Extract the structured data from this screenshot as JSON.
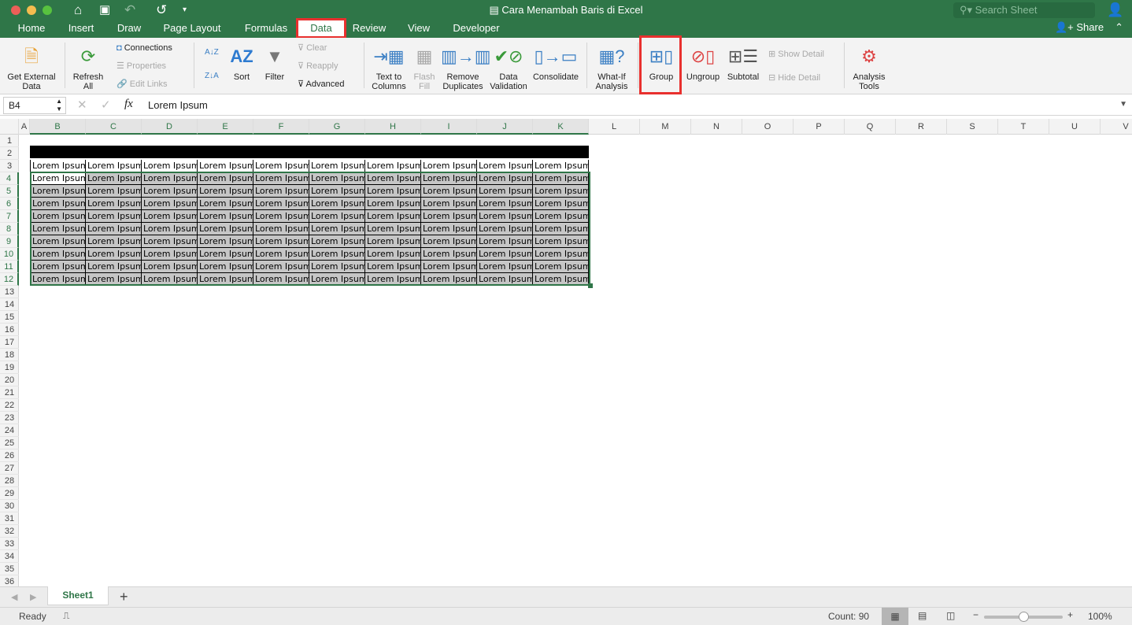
{
  "window": {
    "title": "Cara Menambah Baris di Excel"
  },
  "search": {
    "placeholder": "Search Sheet"
  },
  "tabs": [
    "Home",
    "Insert",
    "Draw",
    "Page Layout",
    "Formulas",
    "Data",
    "Review",
    "View",
    "Developer"
  ],
  "active_tab": "Data",
  "share_label": "Share",
  "ribbon": {
    "get_external": "Get External Data",
    "refresh": "Refresh All",
    "connections": "Connections",
    "properties": "Properties",
    "edit_links": "Edit Links",
    "sort": "Sort",
    "filter": "Filter",
    "clear": "Clear",
    "reapply": "Reapply",
    "advanced": "Advanced",
    "text_to_columns": "Text to Columns",
    "flash_fill": "Flash Fill",
    "remove_duplicates": "Remove Duplicates",
    "data_validation": "Data Validation",
    "consolidate": "Consolidate",
    "what_if": "What-If Analysis",
    "group": "Group",
    "ungroup": "Ungroup",
    "subtotal": "Subtotal",
    "show_detail": "Show Detail",
    "hide_detail": "Hide Detail",
    "analysis_tools": "Analysis Tools"
  },
  "formula_bar": {
    "name_box": "B4",
    "fx": "fx",
    "value": "Lorem Ipsum"
  },
  "columns": [
    "A",
    "B",
    "C",
    "D",
    "E",
    "F",
    "G",
    "H",
    "I",
    "J",
    "K",
    "L",
    "M",
    "N",
    "O",
    "P",
    "Q",
    "R",
    "S",
    "T",
    "U",
    "V"
  ],
  "rows": [
    "1",
    "2",
    "3",
    "4",
    "5",
    "6",
    "7",
    "8",
    "9",
    "10",
    "11",
    "12",
    "13",
    "14",
    "15",
    "16",
    "17",
    "18",
    "19",
    "20",
    "21",
    "22",
    "23",
    "24",
    "25",
    "26",
    "27",
    "28",
    "29",
    "30",
    "31",
    "32",
    "33",
    "34",
    "35",
    "36"
  ],
  "cell_text": "Lorem Ipsum",
  "sheets": [
    {
      "name": "Sheet1",
      "active": true
    }
  ],
  "add_sheet": "+",
  "status": {
    "ready": "Ready",
    "count": "Count: 90",
    "zoom": "100%",
    "zoom_fraction": 0.5
  }
}
